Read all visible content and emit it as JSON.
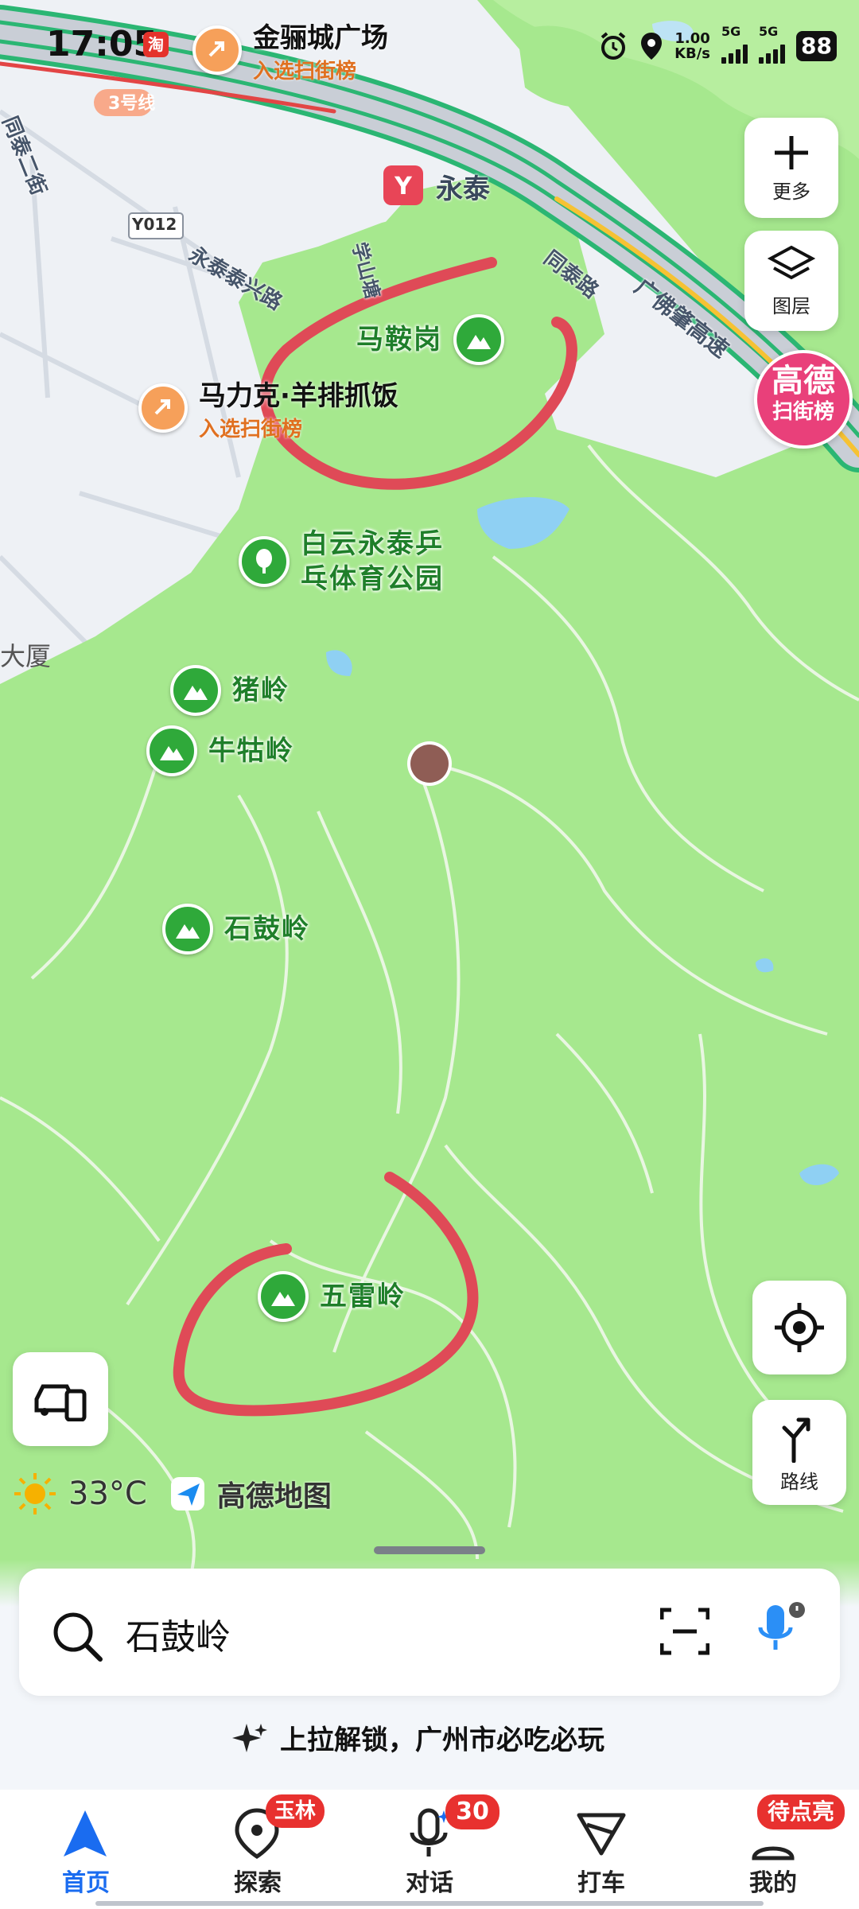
{
  "status_bar": {
    "time": "17:05",
    "app_badge": "淘",
    "net_speed_value": "1.00",
    "net_speed_unit": "KB/s",
    "sim1": "5G",
    "sim2": "5G",
    "battery": "88"
  },
  "map": {
    "place_top": {
      "name": "金骊城广场",
      "tag": "入选扫街榜"
    },
    "place_food": {
      "name": "马力克·羊排抓饭",
      "tag": "入选扫街榜"
    },
    "metro_station": "永泰",
    "metro_line": "3号线",
    "road_code": "Y012",
    "roads": [
      "同泰二街",
      "永泰泰兴路",
      "学山塘",
      "同泰路",
      "广佛肇高速"
    ],
    "edge_label": "大厦",
    "pois": [
      "马鞍岗",
      "白云永泰乒乓体育公园",
      "猪岭",
      "牛牯岭",
      "石鼓岭",
      "五雷岭"
    ],
    "promo": {
      "line1": "高德",
      "line2": "扫街榜"
    },
    "weather": "33°C",
    "brand": "高德地图"
  },
  "tools": {
    "more": "更多",
    "layers": "图层",
    "route": "路线"
  },
  "search": {
    "value": "石鼓岭"
  },
  "promo_text": "上拉解锁，广州市必吃必玩",
  "tabs": [
    {
      "label": "首页",
      "badge": ""
    },
    {
      "label": "探索",
      "badge": "玉林"
    },
    {
      "label": "对话",
      "badge": "30"
    },
    {
      "label": "打车",
      "badge": ""
    },
    {
      "label": "我的",
      "badge": "待点亮"
    }
  ],
  "colors": {
    "accent": "#1a6cf0",
    "badge": "#e8312f",
    "park": "#a6e88e",
    "annotation": "#df4a57"
  }
}
